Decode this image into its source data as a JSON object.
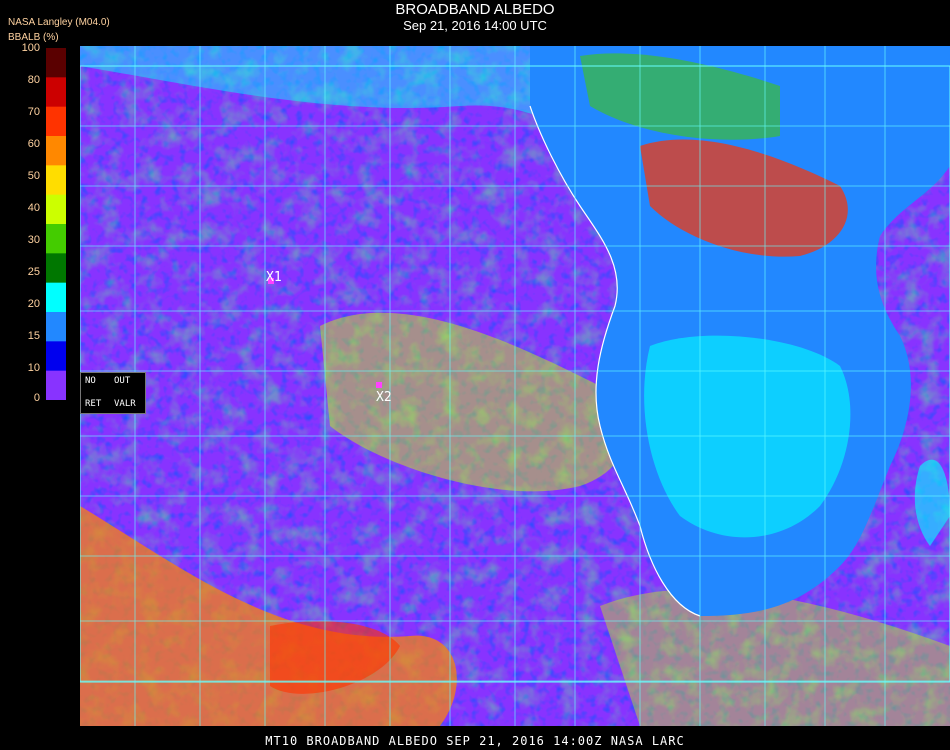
{
  "header": {
    "title": "BROADBAND ALBEDO",
    "subtitle": "Sep 21, 2016 14:00 UTC",
    "source": "NASA Langley (M04.0)",
    "unit": "BBALB (%)"
  },
  "scale": {
    "ticks": [
      "100",
      "80",
      "70",
      "60",
      "50",
      "40",
      "30",
      "25",
      "20",
      "15",
      "10",
      "0"
    ],
    "colors": [
      "#5a0000",
      "#cc0000",
      "#ff3300",
      "#ff8800",
      "#ffdd00",
      "#ccff00",
      "#44cc00",
      "#007700",
      "#00ffff",
      "#2288ff",
      "#0000ee",
      "#8833ff"
    ]
  },
  "status_box": {
    "no": "NO",
    "out": "OUT",
    "ret": "RET",
    "valr": "VALR"
  },
  "markers": {
    "x1": "X1",
    "x2": "X2"
  },
  "footer": "MT10  BROADBAND ALBEDO  SEP 21, 2016 14:00Z  NASA LARC",
  "palette": {
    "ocean_low": "#8833ff",
    "ocean_mid": "#0000ee",
    "cloud_light": "#00ffff",
    "cloud_mid": "#ccff00",
    "cloud_high": "#ff8800",
    "grid": "#66ffff",
    "land": "#2288ff"
  }
}
